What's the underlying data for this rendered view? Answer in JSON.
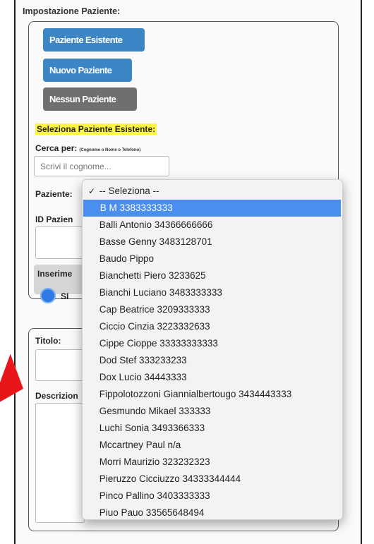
{
  "settings": {
    "title": "Impostazione Paziente:",
    "buttons": [
      "Paziente Esistente",
      "Nuovo Paziente",
      "Nessun Paziente"
    ],
    "select_existing_label": "Seleziona Paziente Esistente:",
    "search_label": "Cerca per:",
    "search_hint": "(Cognome o Nome o Telefono)",
    "search_placeholder": "Scrivi il cognome...",
    "patient_label": "Paziente:",
    "id_label": "ID Pazien",
    "insert_label": "Inserime",
    "radio_si": "SI"
  },
  "form2": {
    "title_label": "Titolo:",
    "description_label": "Descrizion"
  },
  "dropdown": {
    "options": [
      "-- Seleziona --",
      "B M 3383333333",
      "Balli Antonio 34366666666",
      "Basse Genny 3483128701",
      "Baudo Pippo",
      "Bianchetti Piero 3233625",
      "Bianchi Luciano 3483333333",
      "Cap Beatrice 3209333333",
      "Ciccio Cinzia 3223332633",
      "Cippe Cioppe 33333333333",
      "Dod Stef 333233233",
      "Dox Lucio 34443333",
      "Fippolotozzoni Giannialbertougo 3434443333",
      "Gesmundo Mikael 333333",
      "Luchi Sonia 3493366333",
      "Mccartney Paul n/a",
      "Morri Maurizio 323232323",
      "Pieruzzo Cicciuzzo 34333344444",
      "Pinco Pallino 3403333333",
      "Piuo Pauo 33565648494"
    ],
    "checked_index": 0,
    "highlighted_index": 1
  }
}
